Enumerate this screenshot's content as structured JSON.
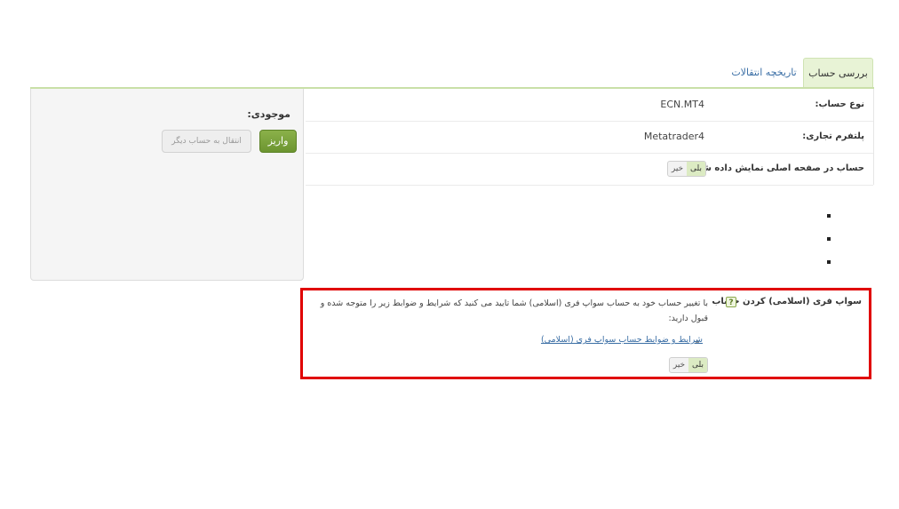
{
  "tabs": {
    "active_label": "بررسی حساب",
    "history_label": "تاریخچه انتقالات"
  },
  "balance": {
    "label": "موجودی:",
    "deposit_button": "واریز",
    "transfer_button": "انتقال به حساب دیگر"
  },
  "account_info": {
    "rows": [
      {
        "label": "نوع حساب:",
        "value": "ECN.MT4"
      },
      {
        "label": "پلتفرم تجاری:",
        "value": "Metatrader4"
      },
      {
        "label": "حساب در صفحه اصلی نمایش داده شود؟",
        "toggle_yes": "بلی",
        "toggle_no": "خیر"
      }
    ]
  },
  "swap_free": {
    "label": "سواپ فری (اسلامی) کردن حساب",
    "help_icon": "?",
    "description": "با تغییر حساب خود به حساب سواپ فری (اسلامی) شما تایید می کنید که شرایط و ضوابط زیر را متوجه شده و قبول دارید:",
    "link_text": "شرایط و ضوابط حساب سواپ فری (اسلامی)",
    "toggle_yes": "بلی",
    "toggle_no": "خیر"
  },
  "colors": {
    "highlight": "#e00000",
    "deposit_green": "#6c9530",
    "tab_active_bg": "#e8f3d6"
  }
}
